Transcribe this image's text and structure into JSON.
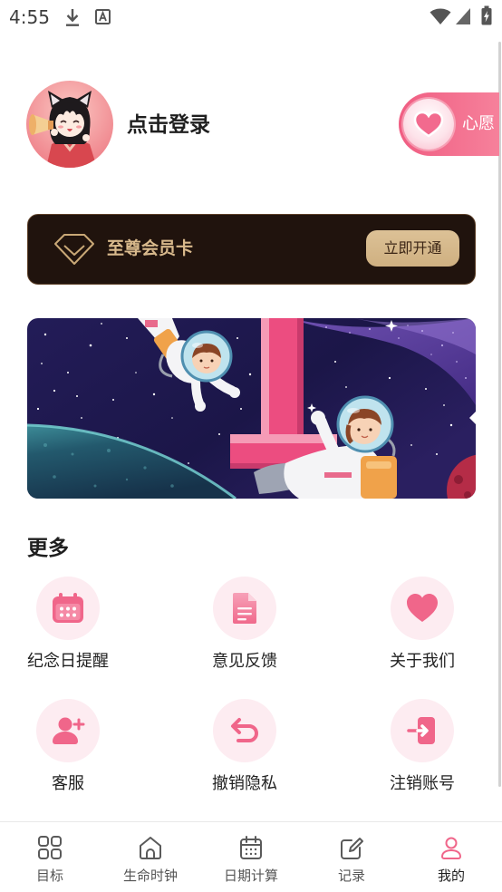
{
  "status_bar": {
    "time": "4:55",
    "icons": [
      "download-icon",
      "autofill-icon",
      "wifi-icon",
      "signal-icon",
      "battery-charging-icon"
    ]
  },
  "profile": {
    "login_label": "点击登录",
    "avatar_icon": "avatar"
  },
  "wish_button": {
    "label": "心愿",
    "icon": "heart-icon"
  },
  "membership": {
    "title": "至尊会员卡",
    "action_label": "立即开通",
    "icon": "diamond-icon"
  },
  "banner": {
    "icon": "space-astronaut-illustration"
  },
  "more": {
    "heading": "更多",
    "items": [
      {
        "label": "纪念日提醒",
        "icon": "calendar-icon"
      },
      {
        "label": "意见反馈",
        "icon": "document-icon"
      },
      {
        "label": "关于我们",
        "icon": "heart-icon"
      },
      {
        "label": "客服",
        "icon": "add-person-icon"
      },
      {
        "label": "撤销隐私",
        "icon": "undo-icon"
      },
      {
        "label": "注销账号",
        "icon": "logout-icon"
      }
    ]
  },
  "bottom_nav": {
    "items": [
      {
        "label": "目标",
        "icon": "grid-icon",
        "active": false
      },
      {
        "label": "生命时钟",
        "icon": "home-icon",
        "active": false
      },
      {
        "label": "日期计算",
        "icon": "calendar-icon",
        "active": false
      },
      {
        "label": "记录",
        "icon": "edit-icon",
        "active": false
      },
      {
        "label": "我的",
        "icon": "user-icon",
        "active": true
      }
    ]
  },
  "colors": {
    "accent": "#f0668a",
    "accent_light": "#fdecf1",
    "member_card_bg": "#20130d",
    "member_gold": "#d8b98c",
    "nav_text": "#555555",
    "nav_active_text": "#1f1f1f"
  }
}
